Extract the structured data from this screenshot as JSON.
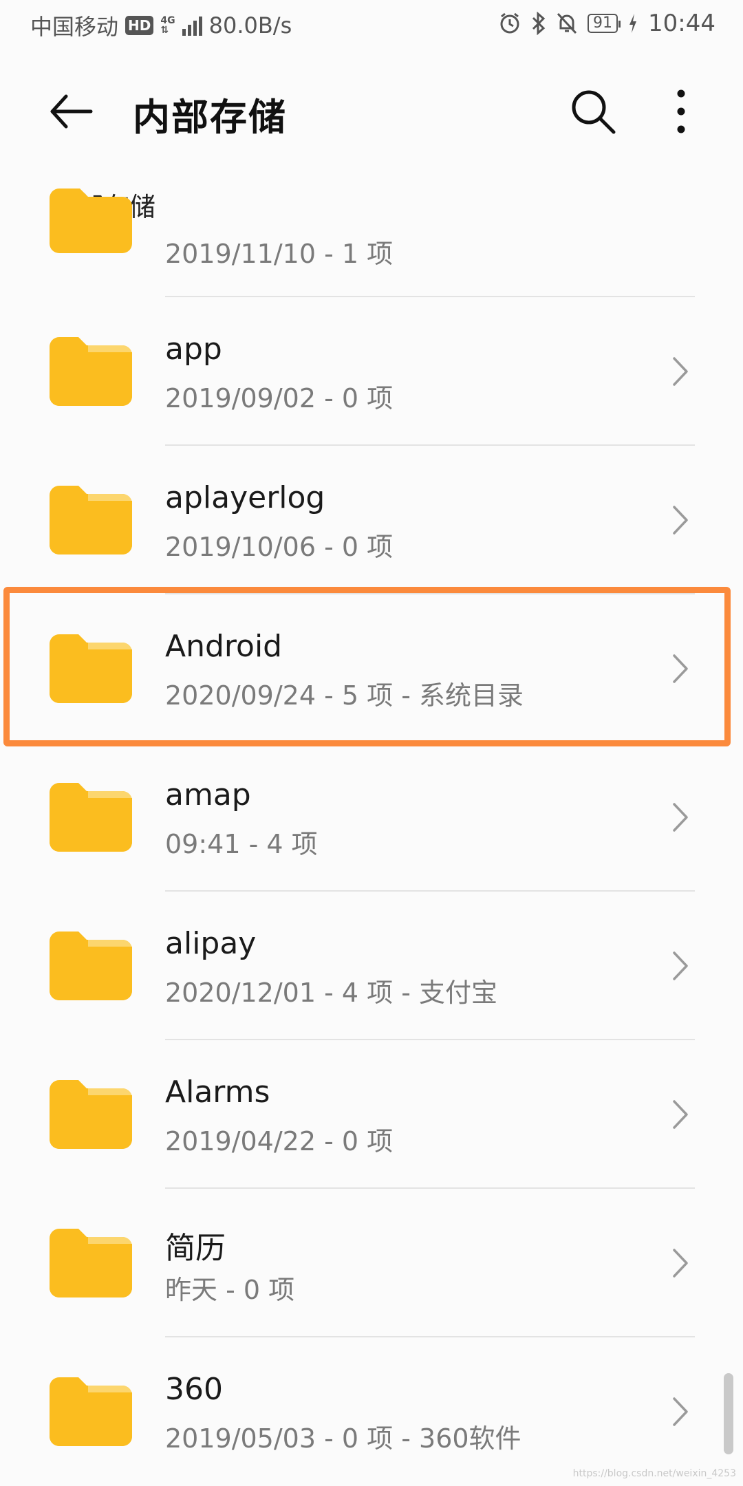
{
  "status_bar": {
    "carrier": "中国移动",
    "hd_badge": "HD",
    "network": "4G",
    "speed": "80.0B/s",
    "battery": "91",
    "time": "10:44",
    "icons": [
      "alarm-icon",
      "bluetooth-icon",
      "mute-bell-icon",
      "battery-icon",
      "charging-icon"
    ]
  },
  "app_bar": {
    "title": "内部存储",
    "icons": [
      "back-arrow-icon",
      "search-icon",
      "more-vertical-icon"
    ]
  },
  "breadcrumb": "内部存储",
  "partial_row": {
    "meta": "2019/11/10 - 1 项"
  },
  "folders": [
    {
      "name": "app",
      "meta": "2019/09/02 - 0 项"
    },
    {
      "name": "aplayerlog",
      "meta": "2019/10/06 - 0 项"
    },
    {
      "name": "Android",
      "meta": "2020/09/24 - 5 项 - 系统目录"
    },
    {
      "name": "amap",
      "meta": "09:41 - 4 项"
    },
    {
      "name": "alipay",
      "meta": "2020/12/01 - 4 项 - 支付宝"
    },
    {
      "name": "Alarms",
      "meta": "2019/04/22 - 0 项"
    },
    {
      "name": "简历",
      "meta": "昨天 - 0 项"
    },
    {
      "name": "360",
      "meta": "2019/05/03 - 0 项 - 360软件"
    }
  ],
  "highlighted_folder_index": 2,
  "colors": {
    "folder": "#fbbd1f",
    "folder_tab": "#fcd66e",
    "highlight": "#fb8a3c"
  },
  "watermark": "https://blog.csdn.net/weixin_4253"
}
